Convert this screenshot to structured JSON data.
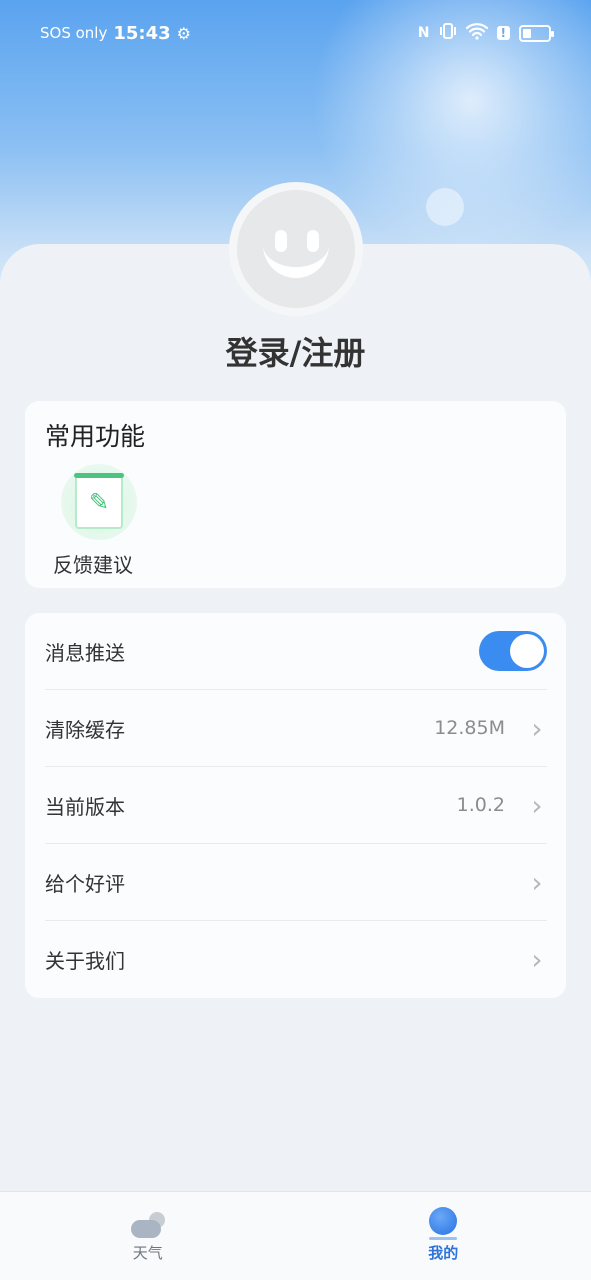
{
  "status_bar": {
    "sos": "SOS only",
    "time": "15:43",
    "gear_icon": "gear-icon",
    "nfc_icon": "N",
    "vibrate_icon": "vibrate-icon",
    "wifi_icon": "wifi-icon",
    "alert_icon": "!",
    "battery_icon": "battery-icon"
  },
  "profile": {
    "avatar_icon": "smiley-avatar-icon",
    "login_label": "登录/注册"
  },
  "common_functions": {
    "title": "常用功能",
    "items": [
      {
        "label": "反馈建议",
        "icon": "feedback-icon"
      }
    ]
  },
  "settings": {
    "items": [
      {
        "label": "消息推送",
        "type": "toggle",
        "enabled": true
      },
      {
        "label": "清除缓存",
        "value": "12.85M"
      },
      {
        "label": "当前版本",
        "value": "1.0.2"
      },
      {
        "label": "给个好评",
        "value": ""
      },
      {
        "label": "关于我们",
        "value": ""
      }
    ]
  },
  "tabbar": {
    "tabs": [
      {
        "label": "天气",
        "icon": "weather-icon",
        "active": false
      },
      {
        "label": "我的",
        "icon": "profile-icon",
        "active": true
      }
    ]
  },
  "colors": {
    "accent": "#3b8cf0",
    "feedback_green": "#46c27a",
    "background": "#eef2f6"
  }
}
